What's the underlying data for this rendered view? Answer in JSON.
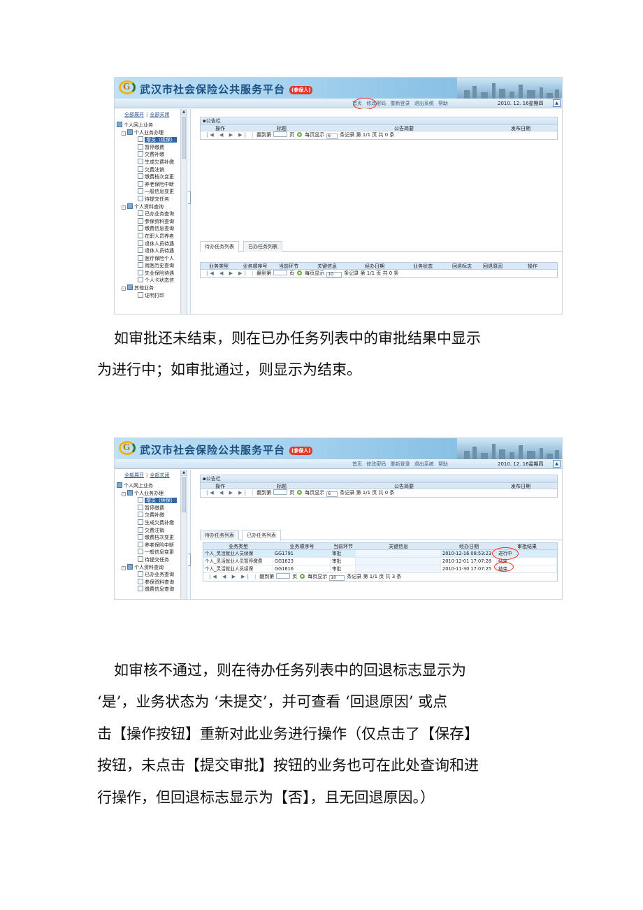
{
  "screenshot1": {
    "header": {
      "title": "武汉市社会保险公共服务平台",
      "tag": "(参保人)"
    },
    "nav": {
      "links": [
        "首页",
        "修改密码",
        "重新登录",
        "退出系统",
        "帮助"
      ],
      "date": "2010. 12. 16星期四"
    },
    "sidebar": {
      "expand_all": "全部展开",
      "divider": "|",
      "collapse_all": "全部关闭",
      "tree": [
        {
          "level": 0,
          "label": "个人网上业务",
          "folder": true
        },
        {
          "level": 1,
          "label": "个人业务办理",
          "folder": true,
          "toggle": "-"
        },
        {
          "level": 2,
          "label": "增员（续保）",
          "selected": true
        },
        {
          "level": 2,
          "label": "暂停缴费"
        },
        {
          "level": 2,
          "label": "欠费补缴"
        },
        {
          "level": 2,
          "label": "生成欠费补缴"
        },
        {
          "level": 2,
          "label": "欠费注销"
        },
        {
          "level": 2,
          "label": "缴费档次变更"
        },
        {
          "level": 2,
          "label": "养老保险中断"
        },
        {
          "level": 2,
          "label": "一般信息变更"
        },
        {
          "level": 2,
          "label": "待提交任务"
        },
        {
          "level": 1,
          "label": "个人资料查询",
          "folder": true,
          "toggle": "-"
        },
        {
          "level": 2,
          "label": "已办业务查询"
        },
        {
          "level": 2,
          "label": "参保资料查询"
        },
        {
          "level": 2,
          "label": "缴费信息查询"
        },
        {
          "level": 2,
          "label": "在职人员养老"
        },
        {
          "level": 2,
          "label": "退休人员待遇"
        },
        {
          "level": 2,
          "label": "退休人员待遇"
        },
        {
          "level": 2,
          "label": "医疗保险个人"
        },
        {
          "level": 2,
          "label": "就医历史查询"
        },
        {
          "level": 2,
          "label": "失业保险待遇"
        },
        {
          "level": 2,
          "label": "个人卡状态信"
        },
        {
          "level": 1,
          "label": "其他业务",
          "folder": true,
          "toggle": "-"
        },
        {
          "level": 2,
          "label": "证明打印"
        }
      ]
    },
    "notice": {
      "title": "公告栏",
      "columns": [
        "操作",
        "标题",
        "公告简要",
        "发布日期"
      ],
      "pager": {
        "nav": "|◀ ◀ ▶ ▶|",
        "goto": "翻到第",
        "page": "页",
        "per_page_label": "每页显示",
        "per_page": "6",
        "records": "条记录",
        "info": "第 1/1 页  共  0  条"
      }
    },
    "tabs": [
      "待办任务列表",
      "已办任务列表"
    ],
    "tasks": {
      "columns": [
        "业务类型",
        "业务顺序号",
        "当前环节",
        "关键信息",
        "经办日期",
        "业务状态",
        "回退标志",
        "回退原因",
        "操作"
      ],
      "pager": {
        "nav": "|◀ ◀ ▶ ▶|",
        "goto": "翻到第",
        "page": "页",
        "per_page_label": "每页显示",
        "per_page": "10",
        "records": "条记录",
        "info": "第 1/1 页  共  0  条"
      }
    }
  },
  "paragraph1": [
    "如审批还未结束，则在已办任务列表中的审批结果中显示",
    "为进行中；如审批通过，则显示为结束。"
  ],
  "screenshot2": {
    "header": {
      "title": "武汉市社会保险公共服务平台",
      "tag": "(参保人)"
    },
    "nav": {
      "links": [
        "首页",
        "修改密码",
        "重新登录",
        "退出系统",
        "帮助"
      ],
      "date": "2010. 12. 16星期四"
    },
    "sidebar": {
      "expand_all": "全部展开",
      "divider": "|",
      "collapse_all": "全部关闭",
      "tree": [
        {
          "level": 0,
          "label": "个人网上业务",
          "folder": true
        },
        {
          "level": 1,
          "label": "个人业务办理",
          "folder": true,
          "toggle": "-"
        },
        {
          "level": 2,
          "label": "增员（续保）",
          "selected": true
        },
        {
          "level": 2,
          "label": "暂停缴费"
        },
        {
          "level": 2,
          "label": "欠费补缴"
        },
        {
          "level": 2,
          "label": "生成欠费补缴"
        },
        {
          "level": 2,
          "label": "欠费注销"
        },
        {
          "level": 2,
          "label": "缴费档次变更"
        },
        {
          "level": 2,
          "label": "养老保险中断"
        },
        {
          "level": 2,
          "label": "一般信息变更"
        },
        {
          "level": 2,
          "label": "待提交任务"
        },
        {
          "level": 1,
          "label": "个人资料查询",
          "folder": true,
          "toggle": "-"
        },
        {
          "level": 2,
          "label": "已办业务查询"
        },
        {
          "level": 2,
          "label": "参保资料查询"
        },
        {
          "level": 2,
          "label": "缴费信息查询"
        }
      ]
    },
    "notice": {
      "title": "公告栏",
      "columns": [
        "操作",
        "标题",
        "公告简要",
        "发布日期"
      ],
      "pager": {
        "nav": "|◀ ◀ ▶ ▶|",
        "goto": "翻到第",
        "page": "页",
        "per_page_label": "每页显示",
        "per_page": "6",
        "records": "条记录",
        "info": "第 1/1 页  共  0  条"
      }
    },
    "tabs": [
      "待办任务列表",
      "已办任务列表"
    ],
    "done": {
      "columns": [
        "业务类型",
        "业务顺序号",
        "当前环节",
        "关键信息",
        "经办日期",
        "审批结果"
      ],
      "rows": [
        {
          "type": "个人_灵活就业人员续保",
          "seq": "GG1791",
          "step": "审批",
          "key": "",
          "date": "2010-12-16 08:53:23",
          "result": "进行中"
        },
        {
          "type": "个人_灵活就业人员暂停缴费",
          "seq": "GG1623",
          "step": "审批",
          "key": "",
          "date": "2010-12-01 17:07:28",
          "result": "结束"
        },
        {
          "type": "个人_灵活就业人员续保",
          "seq": "GG1616",
          "step": "审批",
          "key": "",
          "date": "2010-11-30 17:07:25",
          "result": "结束"
        }
      ],
      "pager": {
        "nav": "|◀ ◀ ▶ ▶|",
        "goto": "翻到第",
        "page": "页",
        "per_page_label": "每页显示",
        "per_page": "10",
        "records": "条记录",
        "info": "第 1/1 页  共  3  条"
      }
    }
  },
  "paragraph2": [
    "如审核不通过，则在待办任务列表中的回退标志显示为",
    "‘是’，业务状态为 ‘未提交’，并可查看 ‘回退原因’ 或点",
    "击【操作按钮】重新对此业务进行操作（仅点击了【保存】",
    "按钮，未点击【提交审批】按钮的业务也可在此处查询和进",
    "行操作，但回退标志显示为【否】，且无回退原因。）"
  ]
}
